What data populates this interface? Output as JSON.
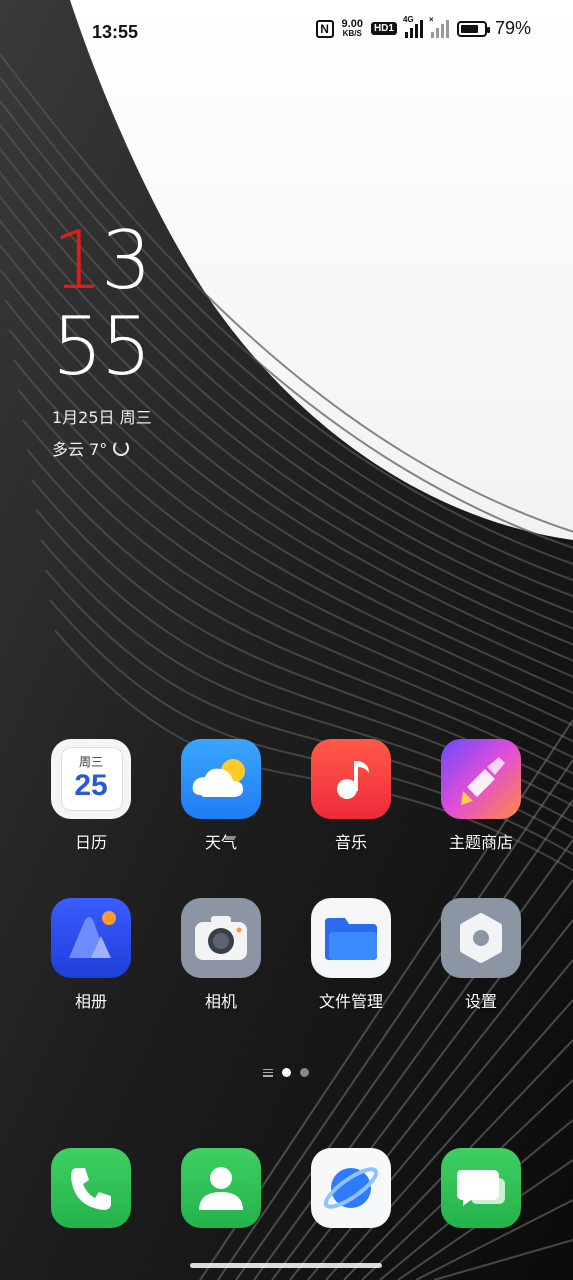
{
  "status_bar": {
    "time": "13:55",
    "nfc": "N",
    "net_speed_value": "9.00",
    "net_speed_unit": "KB/S",
    "hd": "HD1",
    "signal1_tag": "4G",
    "signal2_tag": "×",
    "battery_percent": "79%",
    "battery_level": 0.79
  },
  "clock": {
    "hour_first": "1",
    "hour_second": "3",
    "minutes": "55",
    "date": "1月25日  周三",
    "weather": "多云  7°"
  },
  "apps": [
    {
      "name": "日历",
      "icon": "calendar-icon",
      "weekday": "周三",
      "day": "25"
    },
    {
      "name": "天气",
      "icon": "weather-icon"
    },
    {
      "name": "音乐",
      "icon": "music-icon"
    },
    {
      "name": "主题商店",
      "icon": "theme-store-icon"
    },
    {
      "name": "相册",
      "icon": "gallery-icon"
    },
    {
      "name": "相机",
      "icon": "camera-icon"
    },
    {
      "name": "文件管理",
      "icon": "file-manager-icon"
    },
    {
      "name": "设置",
      "icon": "settings-icon"
    }
  ],
  "dock": [
    {
      "icon": "phone-icon"
    },
    {
      "icon": "contacts-icon"
    },
    {
      "icon": "browser-icon"
    },
    {
      "icon": "messages-icon"
    }
  ],
  "page_indicator": {
    "pages": 2,
    "active": 1
  },
  "colors": {
    "accent_red": "#e21b1b",
    "green": "#2dbd4e",
    "blue": "#1f7cf5"
  }
}
